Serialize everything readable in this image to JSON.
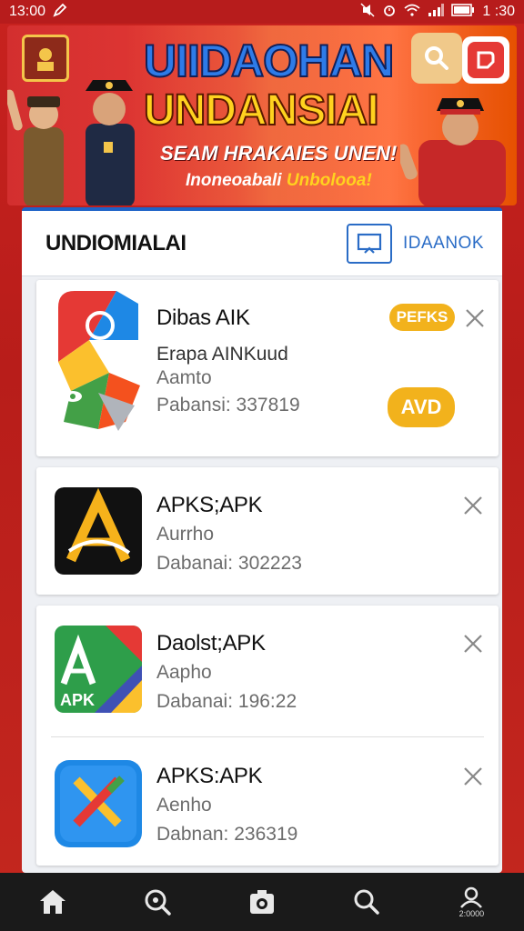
{
  "status_bar": {
    "time": "13:00",
    "clock": "1 :30"
  },
  "banner": {
    "title_line1": "UIIDAOHAN",
    "title_line2": "UNDANSIAI",
    "subtitle": "SEAM HRAKAIES UNEN!",
    "tagline_a": "Inoneoabali",
    "tagline_b": "Unbolooa!"
  },
  "panel": {
    "title": "UNDIOMIALAI",
    "action_label": "IDAANOK"
  },
  "apps": [
    {
      "name": "Dibas AIK",
      "line1": "Erapa AINKuud",
      "line2": "Aamto",
      "line3": "Pabansi: 337819",
      "badge": "PEFKS",
      "button": "AVD"
    },
    {
      "name": "APKS;APK",
      "line1": "Aurrho",
      "line2": "Dabanai: 302223"
    },
    {
      "name": "Daolst;APK",
      "line1": "Aapho",
      "line2": "Dabanai: 196:22",
      "icon_text": "APK"
    },
    {
      "name": "APKS:APK",
      "line1": "Aenho",
      "line2": "Dabnan: 236319"
    }
  ],
  "bottom_nav": {
    "profile_caption": "2:0000"
  },
  "colors": {
    "accent": "#1e63c7",
    "banner_red": "#d32f2f",
    "badge": "#f2b21c"
  }
}
